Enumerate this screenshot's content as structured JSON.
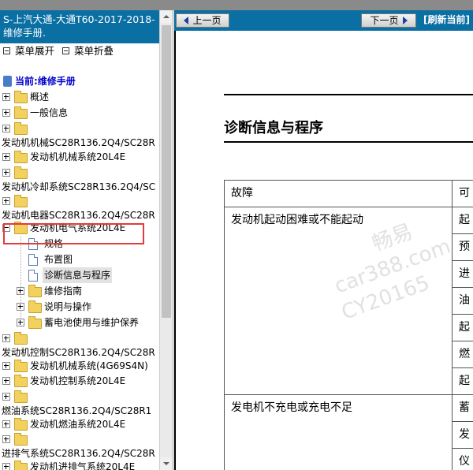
{
  "left_panel": {
    "title": "S-上汽大通-大通T60-2017-2018- 维修手册.",
    "menu": {
      "expand": "菜单展开",
      "collapse": "菜单折叠"
    },
    "current_label": "当前:维修手册",
    "tree": [
      {
        "label": "概述"
      },
      {
        "label": "一般信息"
      },
      {
        "label": ""
      },
      {
        "label": "发动机机械SC28R136.2Q4/SC28R"
      },
      {
        "label": "发动机机械系统20L4E"
      },
      {
        "label": ""
      },
      {
        "label": "发动机冷却系统SC28R136.2Q4/SC"
      },
      {
        "label": ""
      },
      {
        "label": "发动机电器SC28R136.2Q4/SC28R"
      },
      {
        "label": "发动机电气系统20L4E"
      },
      {
        "label": "规格"
      },
      {
        "label": "布置图"
      },
      {
        "label": "诊断信息与程序"
      },
      {
        "label": "维修指南"
      },
      {
        "label": "说明与操作"
      },
      {
        "label": "蓄电池使用与维护保养"
      },
      {
        "label": ""
      },
      {
        "label": "发动机控制SC28R136.2Q4/SC28R"
      },
      {
        "label": "发动机机械系统(4G69S4N)"
      },
      {
        "label": "发动机控制系统20L4E"
      },
      {
        "label": ""
      },
      {
        "label": "燃油系统SC28R136.2Q4/SC28R1"
      },
      {
        "label": "发动机燃油系统20L4E"
      },
      {
        "label": ""
      },
      {
        "label": "进排气系统SC28R136.2Q4/SC28R"
      },
      {
        "label": "发动机进排气系统20L4E"
      }
    ]
  },
  "right_panel": {
    "prev_label": "上一页",
    "next_label": "下一页",
    "refresh_label": "[刷新当前]",
    "heading": "诊断信息与程序",
    "table": {
      "header": [
        "故障",
        "可"
      ],
      "rows": [
        {
          "fault": "发动机起动困难或不能起动",
          "causes": [
            "起",
            "预",
            "进",
            "油",
            "起",
            "燃",
            "起"
          ]
        },
        {
          "fault": "发电机不充电或充电不足",
          "causes": [
            "蓄",
            "发",
            "仪"
          ]
        }
      ]
    },
    "watermark": [
      "畅易",
      "car388.com",
      "CY20165"
    ]
  }
}
